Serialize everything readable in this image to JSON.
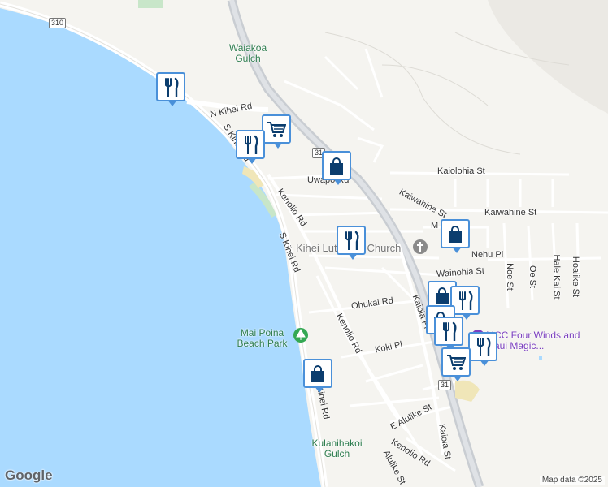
{
  "map": {
    "route_shields": [
      "310",
      "31",
      "31"
    ],
    "roads": {
      "n_kihei_rd": "N Kihei Rd",
      "s_kihei_rd_north": "S Kihei Rd",
      "s_kihei_rd_mid": "S Kihei Rd",
      "s_kihei_rd_south": "S Kihei Rd",
      "kenolio_rd_north": "Kenolio Rd",
      "kenolio_rd_mid": "Kenolio Rd",
      "kenolio_rd_south": "Kenolio Rd",
      "uwapo_rd": "Uwapo Rd",
      "kaiolohia_st": "Kaiolohia St",
      "kaiwahine_st_west": "Kaiwahine St",
      "kaiwahine_st_east": "Kaiwahine St",
      "nehu_pl": "Nehu Pl",
      "wainohia_st": "Wainohia St",
      "ohukai_rd": "Ohukai Rd",
      "koki_pl": "Koki Pl",
      "kaiola_pl": "Kaiola Pl",
      "noe_st": "Noe St",
      "oe_st": "Oe St",
      "hale_kai_st": "Hale Kai St",
      "hoalike_st": "Hoalike St",
      "e_alulike_st": "E Alulike St",
      "kaiola_st": "Kaiola St",
      "alulike_st": "Alulike St",
      "m_partial": "M"
    },
    "places": {
      "waiakoa_gulch": "Waiakoa Gulch",
      "mai_poina_beach_park": "Mai Poina Beach Park",
      "kulanihakoi_gulch": "Kulanihakoi Gulch",
      "church": "Kihei Lutheran Church",
      "mcc": "MCC Four Winds and Maui Magic..."
    },
    "markers": [
      {
        "type": "restaurant",
        "icon": "fork-knife-icon"
      },
      {
        "type": "grocery",
        "icon": "shopping-cart-icon"
      },
      {
        "type": "restaurant",
        "icon": "fork-knife-icon"
      },
      {
        "type": "shopping",
        "icon": "shopping-bag-icon"
      },
      {
        "type": "restaurant",
        "icon": "fork-knife-icon"
      },
      {
        "type": "shopping",
        "icon": "shopping-bag-icon"
      },
      {
        "type": "shopping",
        "icon": "shopping-bag-icon"
      },
      {
        "type": "restaurant",
        "icon": "fork-knife-icon"
      },
      {
        "type": "shopping",
        "icon": "shopping-bag-icon"
      },
      {
        "type": "restaurant",
        "icon": "fork-knife-icon"
      },
      {
        "type": "restaurant",
        "icon": "fork-knife-icon"
      },
      {
        "type": "grocery",
        "icon": "shopping-cart-icon"
      },
      {
        "type": "shopping",
        "icon": "shopping-bag-icon"
      }
    ],
    "colors": {
      "ocean": "#aadaff",
      "land": "#f5f4f0",
      "park": "#c8e6c9",
      "highway": "#c9cdd2",
      "marker_border": "#4a90d9",
      "marker_icon": "#0b3d6e"
    },
    "logo": "Google",
    "attribution": "Map data ©2025"
  }
}
